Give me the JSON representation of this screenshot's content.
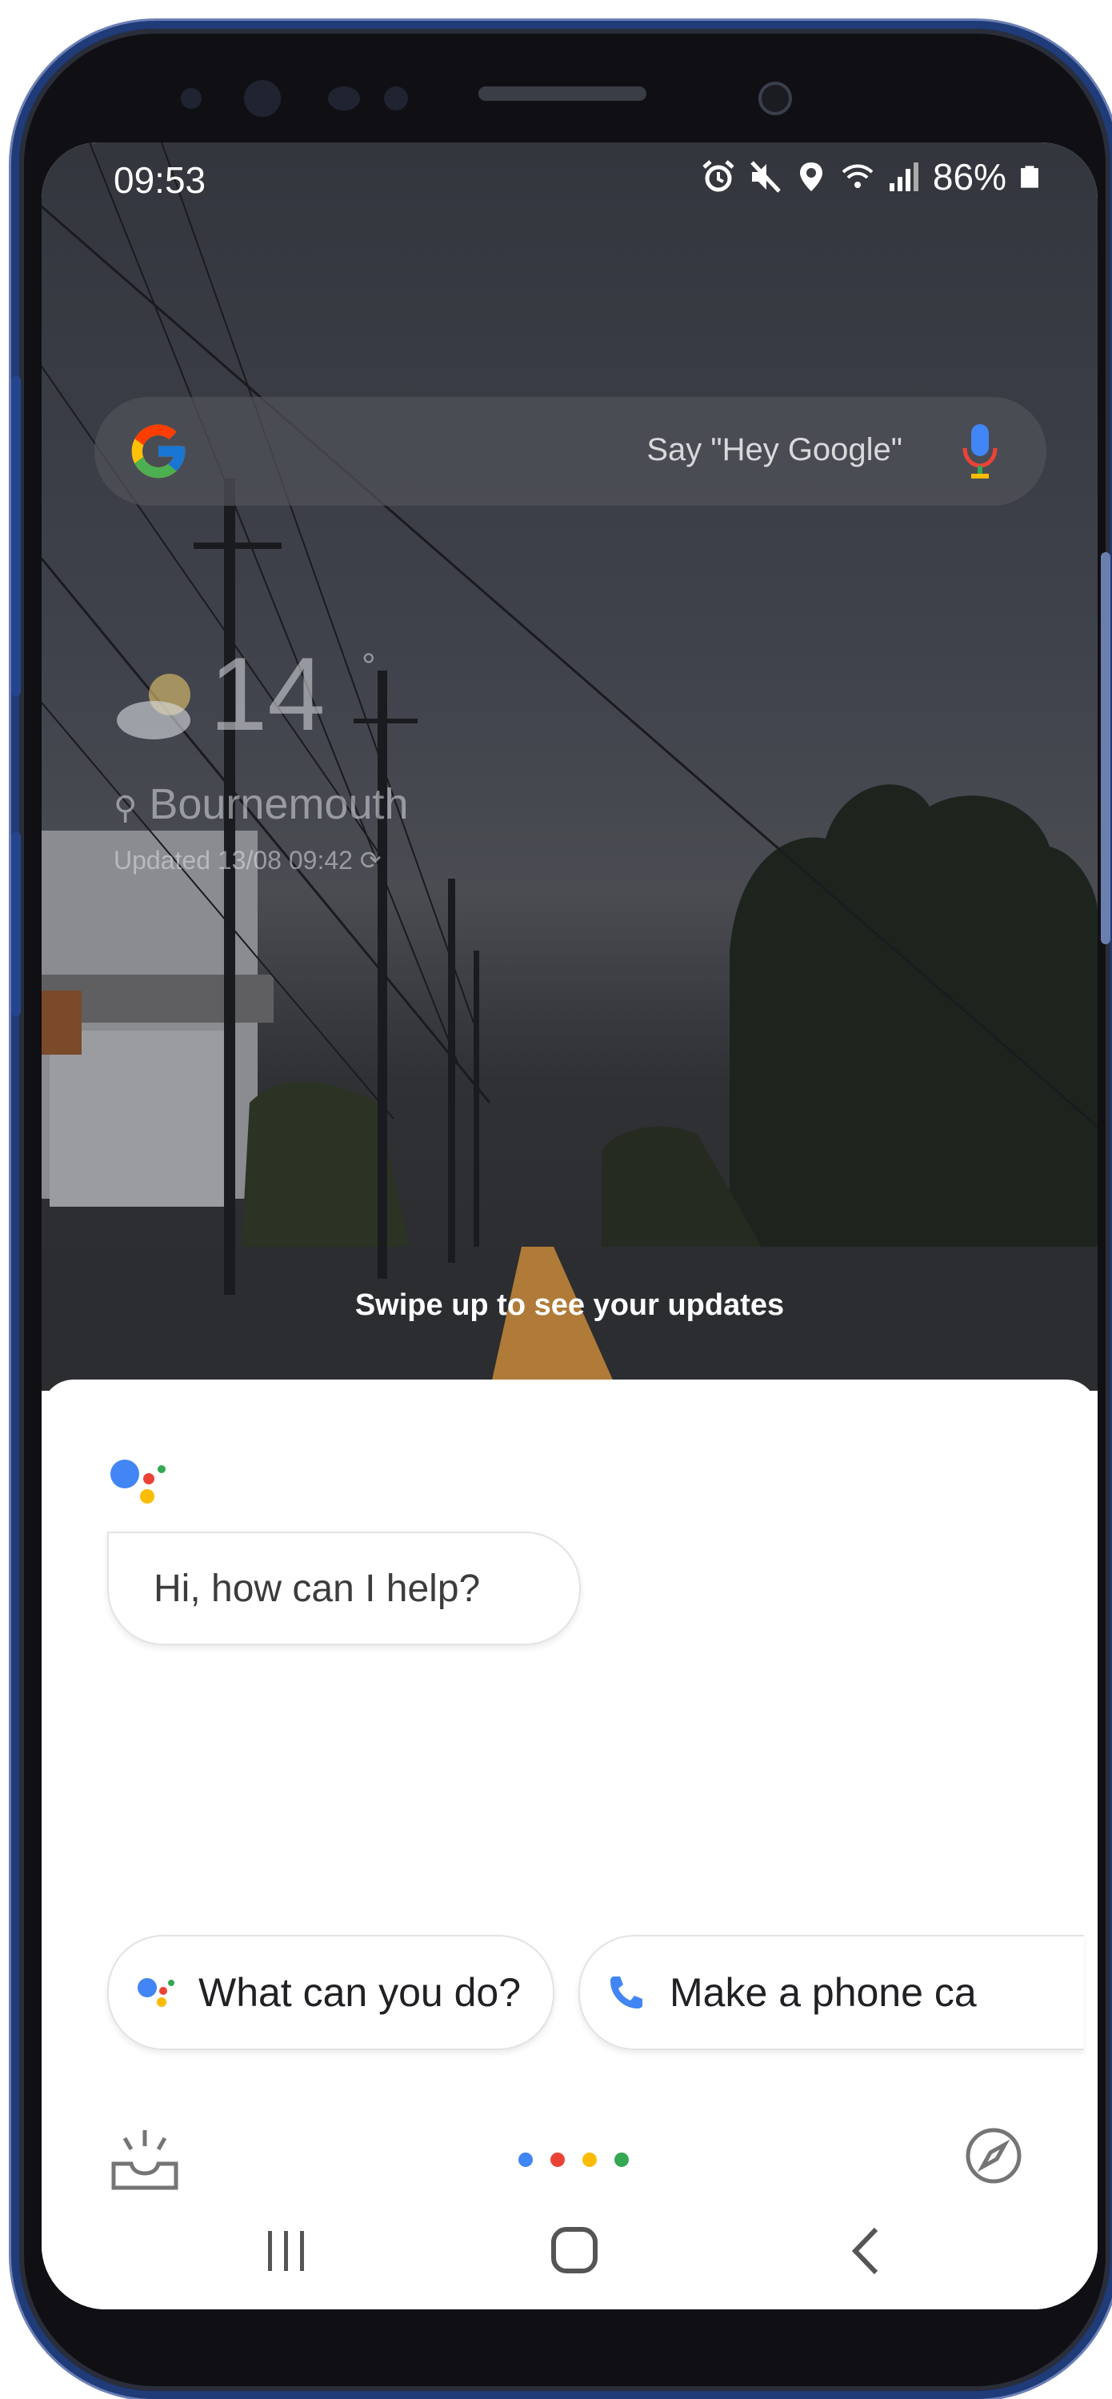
{
  "status_bar": {
    "time": "09:53",
    "battery": "86%",
    "icons": [
      "alarm-icon",
      "mute-icon",
      "location-icon",
      "wifi-icon",
      "signal-icon",
      "battery-icon"
    ]
  },
  "search": {
    "logo": "google-g-logo",
    "hint": "Say \"Hey Google\"",
    "icon": "mic-icon"
  },
  "weather": {
    "icon": "partly-cloudy-icon",
    "temperature": "14",
    "unit": "°",
    "city": "Bournemouth",
    "updated": "Updated 13/08 09:42"
  },
  "swipe_hint": "Swipe up to see your updates",
  "assistant": {
    "greeting": "Hi, how can I help?",
    "chips": [
      {
        "icon": "assistant-icon",
        "label": "What can you do?"
      },
      {
        "icon": "phone-icon",
        "label": "Make a phone ca"
      }
    ]
  },
  "colors": {
    "google_blue": "#4285f4",
    "google_red": "#ea4335",
    "google_yellow": "#fbbc05",
    "google_green": "#34a853",
    "phone_frame": "#1f3b78"
  }
}
